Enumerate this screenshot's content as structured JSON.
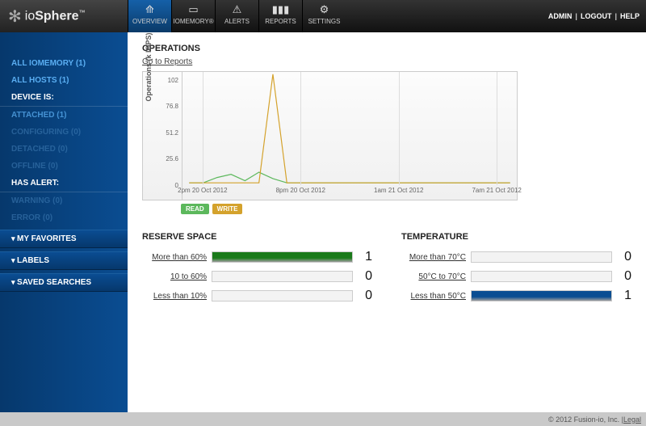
{
  "brand": {
    "name_a": "io",
    "name_b": "Sphere"
  },
  "top_tabs": [
    {
      "label": "OVERVIEW",
      "icon": "pulse",
      "active": true
    },
    {
      "label": "IOMEMORY®",
      "icon": "drive",
      "active": false
    },
    {
      "label": "ALERTS",
      "icon": "alert",
      "active": false
    },
    {
      "label": "REPORTS",
      "icon": "bars",
      "active": false
    },
    {
      "label": "SETTINGS",
      "icon": "gear",
      "active": false
    }
  ],
  "top_links": [
    "ADMIN",
    "LOGOUT",
    "HELP"
  ],
  "sidebar": {
    "items": [
      {
        "kind": "item",
        "label": "ALL IOMEMORY (1)"
      },
      {
        "kind": "item",
        "label": "ALL HOSTS (1)"
      },
      {
        "kind": "head",
        "label": "DEVICE IS:"
      },
      {
        "kind": "sub",
        "label": "ATTACHED (1)"
      },
      {
        "kind": "subd",
        "label": "CONFIGURING (0)"
      },
      {
        "kind": "subd",
        "label": "DETACHED (0)"
      },
      {
        "kind": "subd",
        "label": "OFFLINE (0)"
      },
      {
        "kind": "head",
        "label": "HAS ALERT:"
      },
      {
        "kind": "subd",
        "label": "WARNING (0)"
      },
      {
        "kind": "subd",
        "label": "ERROR (0)"
      },
      {
        "kind": "sect",
        "label": "MY FAVORITES"
      },
      {
        "kind": "sect",
        "label": "LABELS"
      },
      {
        "kind": "sect",
        "label": "SAVED SEARCHES"
      }
    ]
  },
  "operations": {
    "title": "OPERATIONS",
    "link": "Go to Reports",
    "legend_read": "READ",
    "legend_write": "WRITE"
  },
  "chart_data": {
    "type": "line",
    "title": "OPERATIONS",
    "ylabel": "Operations (k IOPS)",
    "ylim": [
      0,
      102
    ],
    "yticks": [
      0,
      25.6,
      51.2,
      76.8,
      102
    ],
    "x_categories": [
      "2pm 20 Oct 2012",
      "8pm 20 Oct 2012",
      "1am 21 Oct 2012",
      "7am 21 Oct 2012"
    ],
    "series": [
      {
        "name": "READ",
        "color": "#5cb85c",
        "values": [
          0,
          0,
          5,
          8,
          2,
          10,
          4,
          0,
          0,
          0,
          0,
          0,
          0,
          0,
          0,
          0,
          0,
          0,
          0,
          0,
          0,
          0,
          0,
          0
        ]
      },
      {
        "name": "WRITE",
        "color": "#d4a22c",
        "values": [
          0,
          0,
          0,
          0,
          0,
          0,
          102,
          0,
          0,
          0,
          0,
          0,
          0,
          0,
          0,
          0,
          0,
          0,
          0,
          0,
          0,
          0,
          0,
          0
        ]
      }
    ]
  },
  "reserve": {
    "title": "RESERVE SPACE",
    "rows": [
      {
        "label": "More than 60%",
        "count": 1,
        "fill": 1.0,
        "color": "#1a7a1a"
      },
      {
        "label": "10 to 60%",
        "count": 0,
        "fill": 0.0,
        "color": "#888"
      },
      {
        "label": "Less than 10%",
        "count": 0,
        "fill": 0.0,
        "color": "#888"
      }
    ]
  },
  "temperature": {
    "title": "TEMPERATURE",
    "rows": [
      {
        "label": "More than 70°C",
        "count": 0,
        "fill": 0.0,
        "color": "#888"
      },
      {
        "label": "50°C to 70°C",
        "count": 0,
        "fill": 0.0,
        "color": "#888"
      },
      {
        "label": "Less than 50°C",
        "count": 1,
        "fill": 1.0,
        "color": "#0a4d92"
      }
    ]
  },
  "footer": {
    "copyright": "© 2012 Fusion-io, Inc. | ",
    "legal": "Legal"
  }
}
